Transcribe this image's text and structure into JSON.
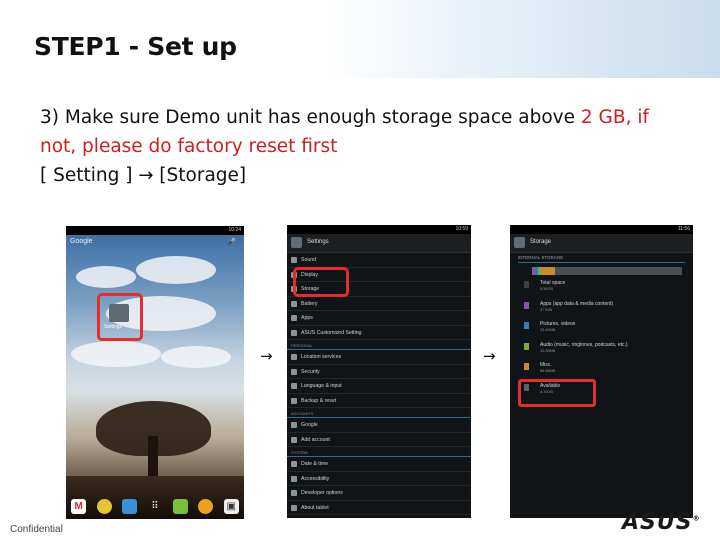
{
  "slide": {
    "title": "STEP1 -  Set up",
    "line1_a": "3) Make sure Demo unit has enough storage space above ",
    "line1_b": "2 GB, if",
    "line2": "not, please do factory reset first",
    "line3_a": "[ Setting ] ",
    "line3_arrow": "→",
    "line3_b": " [Storage]",
    "footer": "Confidential",
    "logo": "ASUS",
    "highlight_color": "#cc1f1f",
    "banner_color": "#c9dced"
  },
  "flow": {
    "arrow1": "→",
    "arrow2": "→"
  },
  "phone1": {
    "time": "10:24",
    "search_label": "Google",
    "widget_label": "Settings",
    "dock_icons": [
      "gmail-icon",
      "chrome-icon",
      "gallery-icon",
      "apps-icon",
      "folder-icon",
      "music-icon",
      "store-icon"
    ]
  },
  "phone2": {
    "time": "10:59",
    "app_title": "Settings",
    "rows": [
      {
        "type": "item",
        "label": "Sound"
      },
      {
        "type": "item",
        "label": "Display"
      },
      {
        "type": "item",
        "label": "Storage"
      },
      {
        "type": "item",
        "label": "Battery"
      },
      {
        "type": "item",
        "label": "Apps"
      },
      {
        "type": "item",
        "label": "ASUS Customized Setting"
      },
      {
        "type": "header",
        "label": "PERSONAL"
      },
      {
        "type": "item",
        "label": "Location services"
      },
      {
        "type": "item",
        "label": "Security"
      },
      {
        "type": "item",
        "label": "Language & input"
      },
      {
        "type": "item",
        "label": "Backup & reset"
      },
      {
        "type": "header",
        "label": "ACCOUNTS"
      },
      {
        "type": "item",
        "label": "Google"
      },
      {
        "type": "item",
        "label": "Add account"
      },
      {
        "type": "header",
        "label": "SYSTEM"
      },
      {
        "type": "item",
        "label": "Date & time"
      },
      {
        "type": "item",
        "label": "Accessibility"
      },
      {
        "type": "item",
        "label": "Developer options"
      },
      {
        "type": "item",
        "label": "About tablet"
      }
    ]
  },
  "phone3": {
    "time": "11:56",
    "app_title": "Storage",
    "section": "INTERNAL STORAGE",
    "rows": [
      {
        "label": "Total space",
        "value": "5.35GB",
        "color": "#3a3f42"
      },
      {
        "label": "Apps (app data & media content)",
        "value": "377MB",
        "color": "#8e4fa6"
      },
      {
        "label": "Pictures, videos",
        "value": "23.40MB",
        "color": "#2e7fbf"
      },
      {
        "label": "Audio (music, ringtones, podcasts, etc.)",
        "value": "10.30MB",
        "color": "#7aa83a"
      },
      {
        "label": "Misc.",
        "value": "68.98MB",
        "color": "#c78a2c"
      },
      {
        "label": "Available",
        "value": "4.70GB",
        "color": "#5a6064"
      }
    ]
  }
}
